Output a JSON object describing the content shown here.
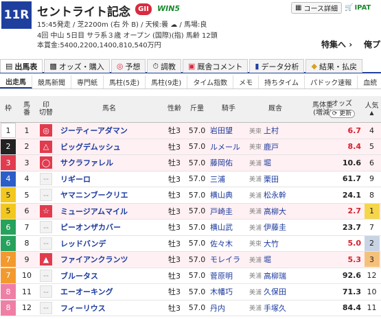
{
  "header": {
    "race_no": "11R",
    "title": "セントライト記念",
    "grade": "GII",
    "win5": "WIN5",
    "course_detail_button": "コース詳細",
    "ipat_button": "IPAT",
    "start_time": "15:45発走",
    "course": "芝2200m (右 外 B)",
    "weather_label": "天候:曇",
    "track_condition": "馬場:良",
    "meeting": "4回 中山 5日目 サラ系３歳 オープン",
    "conditions": "(国際)(指) 馬齢 12頭",
    "prize": "本賞金:5400,2200,1400,810,540万円",
    "special_link": "特集へ",
    "backup_link": "俺プ"
  },
  "tabs": [
    {
      "label": "出馬表",
      "icon": "table-icon"
    },
    {
      "label": "オッズ・購入",
      "icon": "odds-icon"
    },
    {
      "label": "予想",
      "icon": "target-icon"
    },
    {
      "label": "調教",
      "icon": "stopwatch-icon"
    },
    {
      "label": "厩舎コメント",
      "icon": "comment-icon"
    },
    {
      "label": "データ分析",
      "icon": "bar-chart-icon"
    },
    {
      "label": "結果・払戻",
      "icon": "results-icon"
    }
  ],
  "subtabs": [
    "出走馬",
    "競馬新聞",
    "専門紙",
    "馬柱(5走)",
    "馬柱(9走)",
    "タイム指数",
    "メモ",
    "持ちタイム",
    "パドック速報",
    "血統"
  ],
  "table": {
    "headers": {
      "waku": "枠",
      "uma_top": "馬",
      "uma_bottom": "番",
      "mark_top": "印",
      "mark_bottom": "切替",
      "name": "馬名",
      "sex_age": "性齢",
      "kinryo": "斤量",
      "jockey": "騎手",
      "trainer": "厩舎",
      "weight_top": "馬体重",
      "weight_bottom": "(増減)",
      "odds": "オッズ",
      "update": "更新",
      "popularity_top": "人気",
      "popularity_bottom": "▲"
    },
    "rows": [
      {
        "waku": "1",
        "uma": "1",
        "mark": "◎",
        "name": "ジーティーアダマン",
        "sex": "牡3",
        "kin": "57.0",
        "jockey": "岩田望",
        "area": "美東",
        "trainer": "上村",
        "weight": "",
        "odds": "6.7",
        "pop": "4"
      },
      {
        "waku": "2",
        "uma": "2",
        "mark": "△",
        "name": "ビッグデムッシュ",
        "sex": "牡3",
        "kin": "57.0",
        "jockey": "ルメール",
        "area": "美東",
        "trainer": "鹿戸",
        "weight": "",
        "odds": "8.4",
        "pop": "5"
      },
      {
        "waku": "3",
        "uma": "3",
        "mark": "◯",
        "name": "サクラファレル",
        "sex": "牡3",
        "kin": "57.0",
        "jockey": "藤岡佑",
        "area": "美浦",
        "trainer": "堀",
        "weight": "",
        "odds": "10.6",
        "pop": "6"
      },
      {
        "waku": "4",
        "uma": "4",
        "mark": "--",
        "name": "リギーロ",
        "sex": "牡3",
        "kin": "57.0",
        "jockey": "三浦",
        "area": "美浦",
        "trainer": "栗田",
        "weight": "",
        "odds": "61.7",
        "pop": "9"
      },
      {
        "waku": "5",
        "uma": "5",
        "mark": "--",
        "name": "ヤマニンブークリエ",
        "sex": "牡3",
        "kin": "57.0",
        "jockey": "横山典",
        "area": "美浦",
        "trainer": "松永幹",
        "weight": "",
        "odds": "24.1",
        "pop": "8"
      },
      {
        "waku": "5",
        "uma": "6",
        "mark": "☆",
        "name": "ミュージアムマイル",
        "sex": "牡3",
        "kin": "57.0",
        "jockey": "戸崎圭",
        "area": "美浦",
        "trainer": "高柳大",
        "weight": "",
        "odds": "2.7",
        "pop": "1"
      },
      {
        "waku": "6",
        "uma": "7",
        "mark": "--",
        "name": "ピーオンザカバー",
        "sex": "牡3",
        "kin": "57.0",
        "jockey": "横山武",
        "area": "美浦",
        "trainer": "伊藤圭",
        "weight": "",
        "odds": "23.7",
        "pop": "7"
      },
      {
        "waku": "6",
        "uma": "8",
        "mark": "--",
        "name": "レッドバンデ",
        "sex": "牡3",
        "kin": "57.0",
        "jockey": "佐々木",
        "area": "美東",
        "trainer": "大竹",
        "weight": "",
        "odds": "5.0",
        "pop": "2"
      },
      {
        "waku": "7",
        "uma": "9",
        "mark": "▲",
        "name": "ファイアンクランツ",
        "sex": "牡3",
        "kin": "57.0",
        "jockey": "モレイラ",
        "area": "美浦",
        "trainer": "堀",
        "weight": "",
        "odds": "5.3",
        "pop": "3"
      },
      {
        "waku": "7",
        "uma": "10",
        "mark": "--",
        "name": "ブルータス",
        "sex": "牡3",
        "kin": "57.0",
        "jockey": "菅原明",
        "area": "美浦",
        "trainer": "高柳瑞",
        "weight": "",
        "odds": "92.6",
        "pop": "12"
      },
      {
        "waku": "8",
        "uma": "11",
        "mark": "--",
        "name": "エーオーキング",
        "sex": "牡3",
        "kin": "57.0",
        "jockey": "木幡巧",
        "area": "美浦",
        "trainer": "久保田",
        "weight": "",
        "odds": "71.3",
        "pop": "10"
      },
      {
        "waku": "8",
        "uma": "12",
        "mark": "--",
        "name": "フィーリウス",
        "sex": "牡3",
        "kin": "57.0",
        "jockey": "丹内",
        "area": "美浦",
        "trainer": "手塚久",
        "weight": "",
        "odds": "84.4",
        "pop": "11"
      }
    ]
  },
  "colors": {
    "waku": {
      "1": "#ffffff",
      "2": "#222222",
      "3": "#e03b4f",
      "4": "#2c5ec8",
      "5": "#f2c81e",
      "6": "#27a25d",
      "7": "#f39a2e",
      "8": "#ef7fa6"
    },
    "pop": {
      "1": "#f5d64a",
      "2": "#c8d4e4",
      "3": "#f5c17a"
    },
    "accent": "#1f3f9e"
  }
}
